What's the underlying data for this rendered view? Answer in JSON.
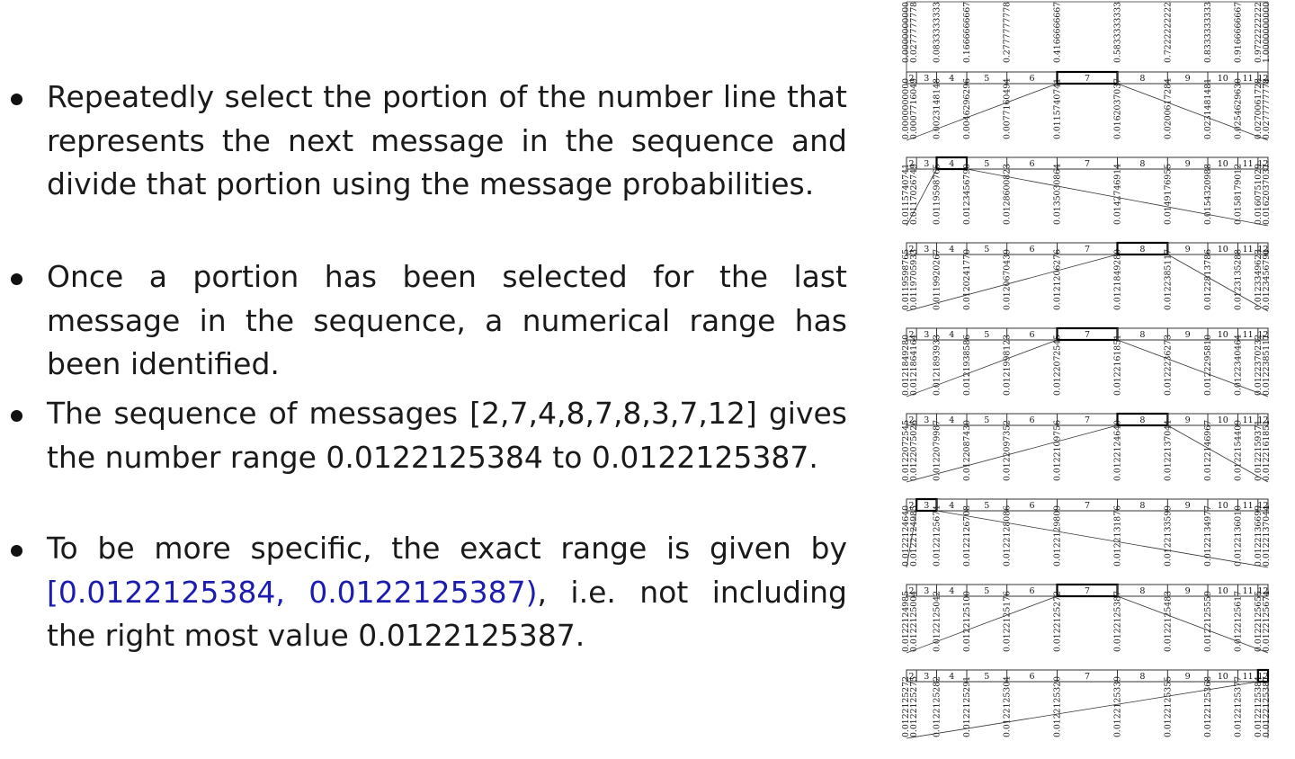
{
  "bullets": [
    {
      "text": "Repeatedly select the portion of the number line that represents the next message in the sequence and divide that portion using the message probabilities."
    },
    {
      "text": "Once a portion has been selected for the last message in the sequence, a numerical range has been identified."
    },
    {
      "text": "The sequence of messages [2,7,4,8,7,8,3,7,12] gives the number range 0.0122125384 to 0.0122125387."
    },
    {
      "pre": "To be more specific, the exact range is given by ",
      "highlight": "[0.0122125384, 0.0122125387)",
      "post": ", i.e. not including the right most value 0.0122125387."
    }
  ],
  "diagram": {
    "colors": {
      "line": "#333333",
      "selected": "#000000"
    },
    "box_labels": [
      "2",
      "3",
      "4",
      "5",
      "6",
      "7",
      "8",
      "9",
      "10",
      "11",
      "12"
    ],
    "box_weights": [
      1,
      2,
      3,
      4,
      5,
      6,
      5,
      4,
      3,
      2,
      1
    ],
    "selected_messages": [
      7,
      4,
      8,
      7,
      8,
      3,
      7,
      12
    ],
    "rows": [
      [
        "0.0000000000",
        "0.0277777778",
        "0.0833333333",
        "0.1666666667",
        "0.2777777778",
        "0.4166666667",
        "0.5833333333",
        "0.7222222222",
        "0.8333333333",
        "0.9166666667",
        "0.9722222222",
        "1.0000000000"
      ],
      [
        "0.0000000000",
        "0.0007716049",
        "0.0023148148",
        "0.0046296296",
        "0.0077160494",
        "0.0115740741",
        "0.0162037037",
        "0.0200617284",
        "0.0231481481",
        "0.0254629630",
        "0.0270061728",
        "0.0277777778"
      ],
      [
        "0.0115740741",
        "0.0117026749",
        "0.0119598765",
        "0.0123456790",
        "0.0128600823",
        "0.0135030864",
        "0.0142746914",
        "0.0149176955",
        "0.0154320988",
        "0.0158179012",
        "0.0160751029",
        "0.0162037037"
      ],
      [
        "0.0119598765",
        "0.0119705933",
        "0.0119920267",
        "0.0120241770",
        "0.0120670439",
        "0.0121206276",
        "0.0121849280",
        "0.0122385117",
        "0.0122813786",
        "0.0123135288",
        "0.0123349623",
        "0.0123456790"
      ],
      [
        "0.0121849280",
        "0.0121864164",
        "0.0121893933",
        "0.0121938586",
        "0.0121998123",
        "0.0122072545",
        "0.0122161851",
        "0.0122236273",
        "0.0122295810",
        "0.0122340464",
        "0.0122370232",
        "0.0122385117"
      ],
      [
        "0.0122072545",
        "0.0122075026",
        "0.0122079987",
        "0.0122087430",
        "0.0122097352",
        "0.0122109756",
        "0.0122124640",
        "0.0122137044",
        "0.0122146967",
        "0.0122154409",
        "0.0122159371",
        "0.0122161851"
      ],
      [
        "0.0122124640",
        "0.0122124985",
        "0.0122125674",
        "0.0122126708",
        "0.0122128086",
        "0.0122129809",
        "0.0122131876",
        "0.0122133599",
        "0.0122134977",
        "0.0122136010",
        "0.0122136699",
        "0.0122137044"
      ],
      [
        "0.0122124985",
        "0.0122125004",
        "0.0122125042",
        "0.0122125100",
        "0.0122125176",
        "0.0122125272",
        "0.0122125387",
        "0.0122125483",
        "0.0122125559",
        "0.0122125617",
        "0.0122125655",
        "0.0122125674"
      ],
      [
        "0.0122125272",
        "0.0122125275",
        "0.0122125282",
        "0.0122125291",
        "0.0122125304",
        "0.0122125320",
        "0.0122125339",
        "0.0122125355",
        "0.0122125368",
        "0.0122125377",
        "0.0122125384",
        "0.0122125387"
      ]
    ]
  }
}
